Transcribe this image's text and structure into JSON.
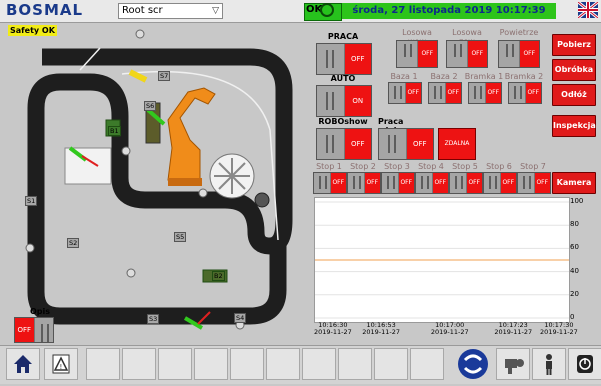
{
  "header": {
    "brand": "BOSMAL",
    "user": "Root scr",
    "ok": "OK",
    "datetime": "środa, 27 listopada 2019 10:17:39"
  },
  "safety": "Safety OK",
  "track": {
    "sensors": [
      "S1",
      "S2",
      "S3",
      "S4",
      "S5",
      "S6",
      "S7"
    ],
    "carriers": [
      "B1",
      "B2",
      "B3"
    ]
  },
  "controls": {
    "praca": {
      "label": "PRACA",
      "state": "OFF"
    },
    "auto": {
      "label": "AUTO",
      "state": "ON"
    },
    "roboshow": {
      "label": "ROBOshow",
      "state": "OFF"
    },
    "zdalna": {
      "label": "Praca zdalna",
      "state": "OFF",
      "extra": "ZDALNA"
    },
    "top_toggles": [
      {
        "label": "Losowa wew",
        "state": "OFF"
      },
      {
        "label": "Losowa zew",
        "state": "OFF"
      },
      {
        "label": "Powietrze",
        "state": "OFF"
      }
    ],
    "baza": [
      {
        "label": "Baza 1",
        "state": "OFF"
      },
      {
        "label": "Baza 2",
        "state": "OFF"
      },
      {
        "label": "Bramka 1",
        "state": "OFF"
      },
      {
        "label": "Bramka 2",
        "state": "OFF"
      }
    ],
    "stops": [
      {
        "label": "Stop 1",
        "state": "OFF"
      },
      {
        "label": "Stop 2",
        "state": "OFF"
      },
      {
        "label": "Stop 3",
        "state": "OFF"
      },
      {
        "label": "Stop 4",
        "state": "OFF"
      },
      {
        "label": "Stop 5",
        "state": "OFF"
      },
      {
        "label": "Stop 6",
        "state": "OFF"
      },
      {
        "label": "Stop 7",
        "state": "OFF"
      }
    ]
  },
  "side_buttons": [
    "Pobierz",
    "Obróbka",
    "Odłóż",
    "Inspekcja",
    "Kamera"
  ],
  "opis": {
    "label": "Opis",
    "state": "OFF"
  },
  "chart_data": {
    "type": "line",
    "y_ticks": [
      "100",
      "80",
      "60",
      "40",
      "20",
      "0"
    ],
    "ylim": [
      0,
      100
    ],
    "x_ticks": [
      [
        "10:16:30",
        "2019-11-27"
      ],
      [
        "10:16:53",
        "2019-11-27"
      ],
      [
        "10:17:00",
        "2019-11-27"
      ],
      [
        "10:17:23",
        "2019-11-27"
      ],
      [
        "10:17:30",
        "2019-11-27"
      ]
    ],
    "series": [
      {
        "values": [
          50,
          50,
          50,
          50,
          50
        ],
        "color": "#f0a050"
      }
    ],
    "grid": true
  },
  "toolbar": {
    "icons": [
      "home-icon",
      "alarm-icon",
      "logo-icon",
      "robot-camera-icon",
      "person-icon",
      "power-icon"
    ]
  },
  "colors": {
    "accent_red": "#ee1212",
    "ok_green": "#27c21d",
    "track": "#1f1f1f"
  }
}
